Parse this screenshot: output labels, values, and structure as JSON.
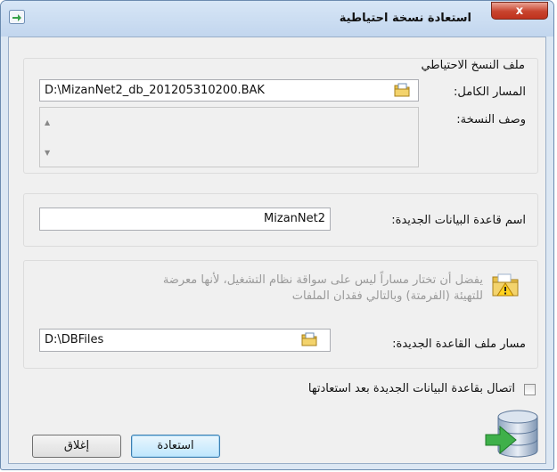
{
  "window": {
    "title": "استعادة نسخة احتياطية",
    "close_label": "x"
  },
  "backup_group": {
    "legend": "ملف النسخ الاحتياطي",
    "full_path_label": "المسار الكامل:",
    "full_path_value": "D:\\MizanNet2_db_201205310200.BAK",
    "description_label": "وصف النسخة:"
  },
  "new_db": {
    "name_label": "اسم قاعدة البيانات الجديدة:",
    "name_value": "MizanNet2"
  },
  "file_path_group": {
    "warning_line1": "يفضل أن تختار مساراً ليس على سواقة نظام التشغيل، لأنها معرضة",
    "warning_line2": "للتهيئة (الفرمتة) وبالتالي فقدان الملفات",
    "path_label": "مسار ملف القاعدة الجديدة:",
    "path_value": "D:\\DBFiles"
  },
  "connect_checkbox": {
    "label": "اتصال بقاعدة البيانات الجديدة بعد استعادتها",
    "checked": false
  },
  "buttons": {
    "restore": "استعادة",
    "close": "إغلاق"
  },
  "icons": {
    "app": "restore-app-icon",
    "browse": "folder-icon",
    "warning": "warning-folder-icon",
    "database": "database-restore-icon"
  }
}
